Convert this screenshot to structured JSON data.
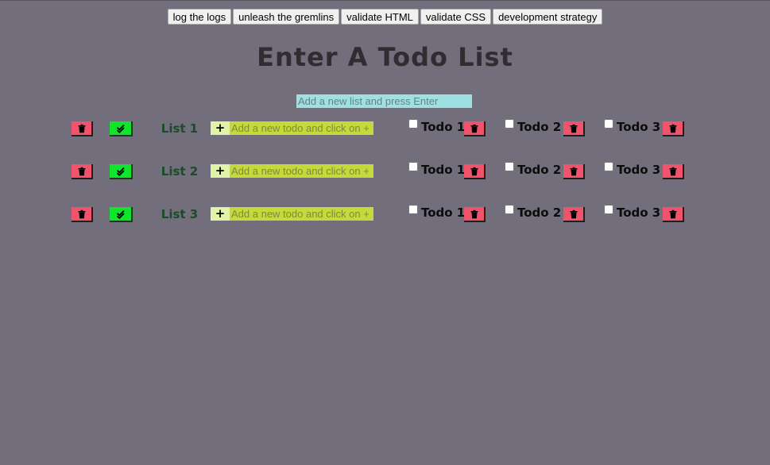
{
  "toolbar": {
    "buttons": [
      "log the logs",
      "unleash the gremlins",
      "validate HTML",
      "validate CSS",
      "development strategy"
    ]
  },
  "header": {
    "title": "Enter A Todo List"
  },
  "new_list": {
    "placeholder": "Add a new list and press Enter"
  },
  "lists": [
    {
      "title": "List 1",
      "add_placeholder": "Add a new todo and click on +",
      "add_label": "+",
      "todos": [
        {
          "label": "Todo 1",
          "checked": false
        },
        {
          "label": "Todo 2",
          "checked": false
        },
        {
          "label": "Todo 3",
          "checked": false
        }
      ]
    },
    {
      "title": "List 2",
      "add_placeholder": "Add a new todo and click on +",
      "add_label": "+",
      "todos": [
        {
          "label": "Todo 1",
          "checked": false
        },
        {
          "label": "Todo 2",
          "checked": false
        },
        {
          "label": "Todo 3",
          "checked": false
        }
      ]
    },
    {
      "title": "List 3",
      "add_placeholder": "Add a new todo and click on +",
      "add_label": "+",
      "todos": [
        {
          "label": "Todo 1",
          "checked": false
        },
        {
          "label": "Todo 2",
          "checked": false
        },
        {
          "label": "Todo 3",
          "checked": false
        }
      ]
    }
  ],
  "icons": {
    "delete": "trash-icon",
    "complete": "double-check-icon",
    "add": "plus-icon"
  },
  "colors": {
    "background": "#726e7b",
    "delete_button": "#f2536c",
    "complete_button": "#0fe52c",
    "new_list_input": "#9fe0e3",
    "add_todo_input": "#c6d93a",
    "add_button": "#dff4a8",
    "list_title": "#1c4a2a"
  }
}
